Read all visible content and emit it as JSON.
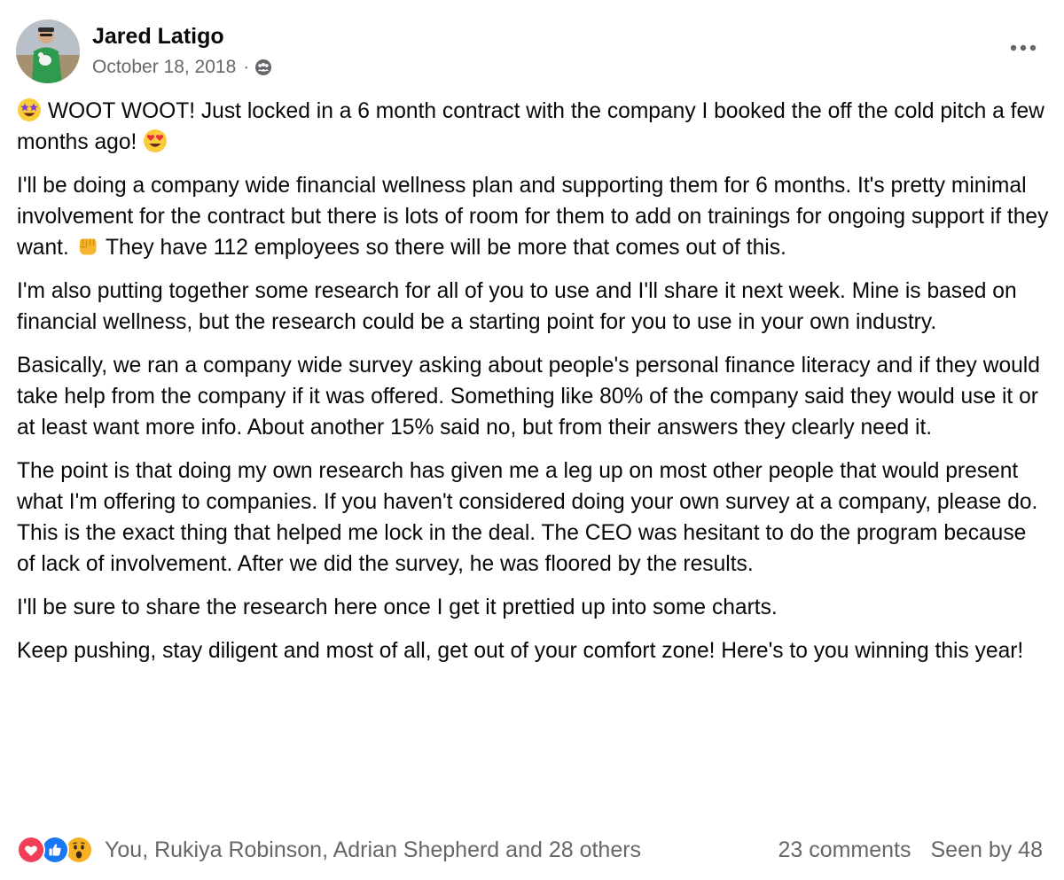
{
  "author": {
    "name": "Jared Latigo",
    "avatar_icon": "profile-photo"
  },
  "post": {
    "date": "October 18, 2018",
    "separator": "·",
    "audience_icon": "group-audience-icon",
    "more_icon": "more-options-icon",
    "paragraphs": [
      {
        "lead_emoji": "star-struck-emoji",
        "text": "WOOT WOOT! Just locked in a 6 month contract with the company I booked the off the cold pitch a few months ago!",
        "trail_emoji": "heart-eyes-emoji"
      },
      {
        "text_before": "I'll be doing a company wide financial wellness plan and supporting them for 6 months. It's pretty minimal involvement for the contract but there is lots of room for them to add on trainings for ongoing support if they want.",
        "mid_emoji": "fist-bump-emoji",
        "text_after": "They have 112 employees so there will be more that comes out of this."
      },
      {
        "text": "I'm also putting together some research for all of you to use and I'll share it next week. Mine is based on financial wellness, but the research could be a starting point for you to use in your own industry."
      },
      {
        "text": "Basically, we ran a company wide survey asking about people's personal finance literacy and if they would take help from the company if it was offered. Something like 80% of the company said they would use it or at least want more info. About another 15% said no, but from their answers they clearly need it."
      },
      {
        "text": "The point is that doing my own research has given me a leg up on most other people that would present what I'm offering to companies. If you haven't considered doing your own survey at a company, please do. This is the exact thing that helped me lock in the deal. The CEO was hesitant to do the program because of lack of involvement. After we did the survey, he was floored by the results."
      },
      {
        "text": "I'll be sure to share the research here once I get it prettied up into some charts."
      },
      {
        "text": "Keep pushing, stay diligent and most of all, get out of your comfort zone! Here's to you winning this year!"
      }
    ]
  },
  "footer": {
    "reactions": [
      "love-reaction-icon",
      "like-reaction-icon",
      "wow-reaction-icon"
    ],
    "reactors_text": "You, Rukiya Robinson, Adrian Shepherd and 28 others",
    "comments_text": "23 comments",
    "seen_text": "Seen by 48"
  },
  "colors": {
    "text_primary": "#080809",
    "text_secondary": "#65676b",
    "like_blue": "#1877f2",
    "love_red": "#f33e58",
    "wow_yellow": "#f7b125"
  }
}
